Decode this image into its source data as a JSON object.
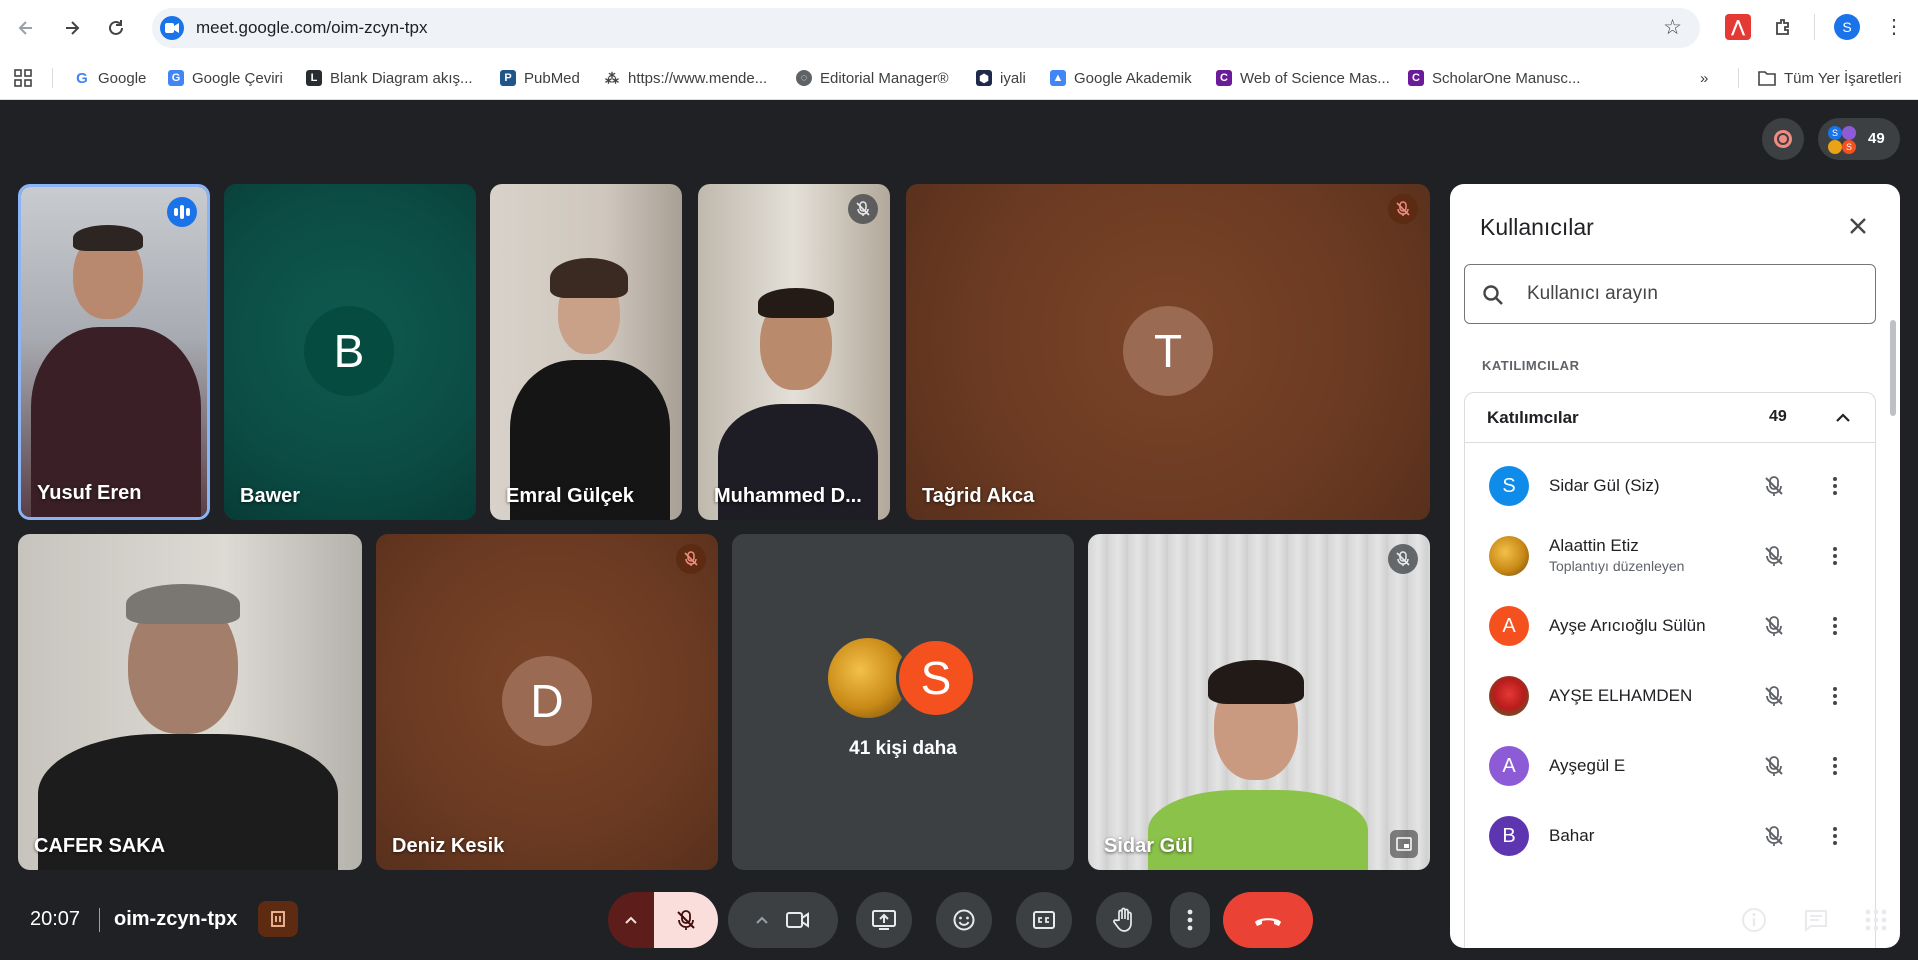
{
  "browser": {
    "url": "meet.google.com/oim-zcyn-tpx",
    "profile_initial": "S",
    "bookmarks": [
      {
        "label": "Google",
        "icon": "google-g-icon"
      },
      {
        "label": "Google Çeviri",
        "icon": "translate-icon"
      },
      {
        "label": "Blank Diagram akış...",
        "icon": "lucidchart-icon"
      },
      {
        "label": "PubMed",
        "icon": "pubmed-icon"
      },
      {
        "label": "https://www.mende...",
        "icon": "mendeley-icon"
      },
      {
        "label": "Editorial Manager®",
        "icon": "globe-icon"
      },
      {
        "label": "iyali",
        "icon": "hex-icon"
      },
      {
        "label": "Google Akademik",
        "icon": "scholar-icon"
      },
      {
        "label": "Web of Science Mas...",
        "icon": "clarivate-icon"
      },
      {
        "label": "ScholarOne Manusc...",
        "icon": "clarivate-icon"
      }
    ],
    "all_bookmarks_label": "Tüm Yer İşaretleri"
  },
  "meet": {
    "participant_count": "49",
    "tiles": [
      {
        "name": "Yusuf Eren",
        "type": "video",
        "speaking": true
      },
      {
        "name": "Bawer",
        "type": "avatar",
        "initial": "B",
        "bg": "#0b4d45",
        "avatar_bg": "#064b3f"
      },
      {
        "name": "Emral Gülçek",
        "type": "video"
      },
      {
        "name": "Muhammed D...",
        "type": "video",
        "muted": true
      },
      {
        "name": "Tağrid Akca",
        "type": "avatar",
        "initial": "T",
        "bg": "#6b3a22",
        "muted": true
      },
      {
        "name": "CAFER SAKA",
        "type": "video"
      },
      {
        "name": "Deniz Kesik",
        "type": "avatar",
        "initial": "D",
        "bg": "#6b3a22",
        "muted": true
      },
      {
        "name": "41 kişi daha",
        "type": "more",
        "initial": "S"
      },
      {
        "name": "Sidar Gül",
        "type": "video",
        "muted": true
      }
    ],
    "clock": "20:07",
    "meeting_code": "oim-zcyn-tpx"
  },
  "panel": {
    "title": "Kullanıcılar",
    "search_placeholder": "Kullanıcı arayın",
    "section_label": "KATILIMCILAR",
    "group_title": "Katılımcılar",
    "group_count": "49",
    "participants": [
      {
        "name": "Sidar Gül (Siz)",
        "sub": "",
        "initial": "S",
        "color": "#0f8ce9"
      },
      {
        "name": "Alaattin Etiz",
        "sub": "Toplantıyı düzenleyen",
        "initial": "",
        "color": "#c98a16"
      },
      {
        "name": "Ayşe Arıcıoğlu Sülün",
        "sub": "",
        "initial": "A",
        "color": "#f4511e"
      },
      {
        "name": "AYŞE ELHAMDEN",
        "sub": "",
        "initial": "",
        "color": "#b71c1c"
      },
      {
        "name": "Ayşegül E",
        "sub": "",
        "initial": "A",
        "color": "#8e5bd6"
      },
      {
        "name": "Bahar",
        "sub": "",
        "initial": "B",
        "color": "#5e35b1"
      }
    ]
  },
  "colors": {
    "accent": "#1a73e8",
    "end_call": "#ea4335",
    "stage_bg": "#202124"
  }
}
